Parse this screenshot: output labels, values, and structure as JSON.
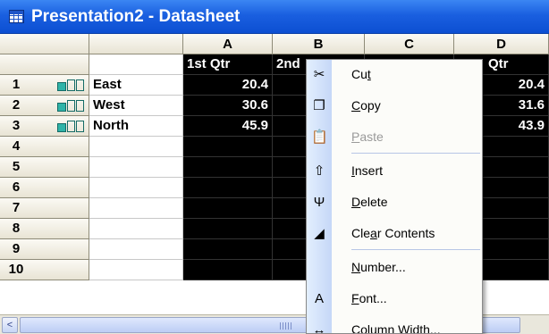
{
  "window": {
    "title": "Presentation2 - Datasheet"
  },
  "columns": [
    "A",
    "B",
    "C",
    "D"
  ],
  "col_headers_row": {
    "a": "1st Qtr",
    "b": "2nd",
    "d": "Qtr"
  },
  "rows": [
    {
      "num": "1",
      "label": "East",
      "a": "20.4",
      "d": "20.4"
    },
    {
      "num": "2",
      "label": "West",
      "a": "30.6",
      "d": "31.6"
    },
    {
      "num": "3",
      "label": "North",
      "a": "45.9",
      "d": "43.9"
    },
    {
      "num": "4"
    },
    {
      "num": "5"
    },
    {
      "num": "6"
    },
    {
      "num": "7"
    },
    {
      "num": "8"
    },
    {
      "num": "9"
    },
    {
      "num": "10"
    }
  ],
  "context_menu": {
    "items": [
      {
        "pre": "Cu",
        "key": "t",
        "post": "",
        "icon": "scissors-icon",
        "glyph": "✂",
        "enabled": true
      },
      {
        "pre": "",
        "key": "C",
        "post": "opy",
        "icon": "copy-icon",
        "glyph": "❐",
        "enabled": true
      },
      {
        "pre": "",
        "key": "P",
        "post": "aste",
        "icon": "paste-icon",
        "glyph": "📋",
        "enabled": false
      },
      {
        "pre": "",
        "key": "I",
        "post": "nsert",
        "icon": "insert-icon",
        "glyph": "⇧",
        "enabled": true
      },
      {
        "pre": "",
        "key": "D",
        "post": "elete",
        "icon": "delete-icon",
        "glyph": "Ψ",
        "enabled": true
      },
      {
        "pre": "Cle",
        "key": "a",
        "post": "r Contents",
        "icon": "eraser-icon",
        "glyph": "◢",
        "enabled": true
      },
      {
        "pre": "",
        "key": "N",
        "post": "umber...",
        "icon": "",
        "glyph": "",
        "enabled": true
      },
      {
        "pre": "",
        "key": "F",
        "post": "ont...",
        "icon": "font-icon",
        "glyph": "A",
        "enabled": true
      },
      {
        "pre": "",
        "key": "",
        "post": "Column Width...",
        "icon": "column-width-icon",
        "glyph": "↔",
        "enabled": true
      }
    ]
  },
  "scrollbar": {
    "left_arrow": "<"
  },
  "colors": {
    "titlebar": "#1a5fe0",
    "selection": "#000000",
    "menu_strip": "#c5d7f7"
  }
}
